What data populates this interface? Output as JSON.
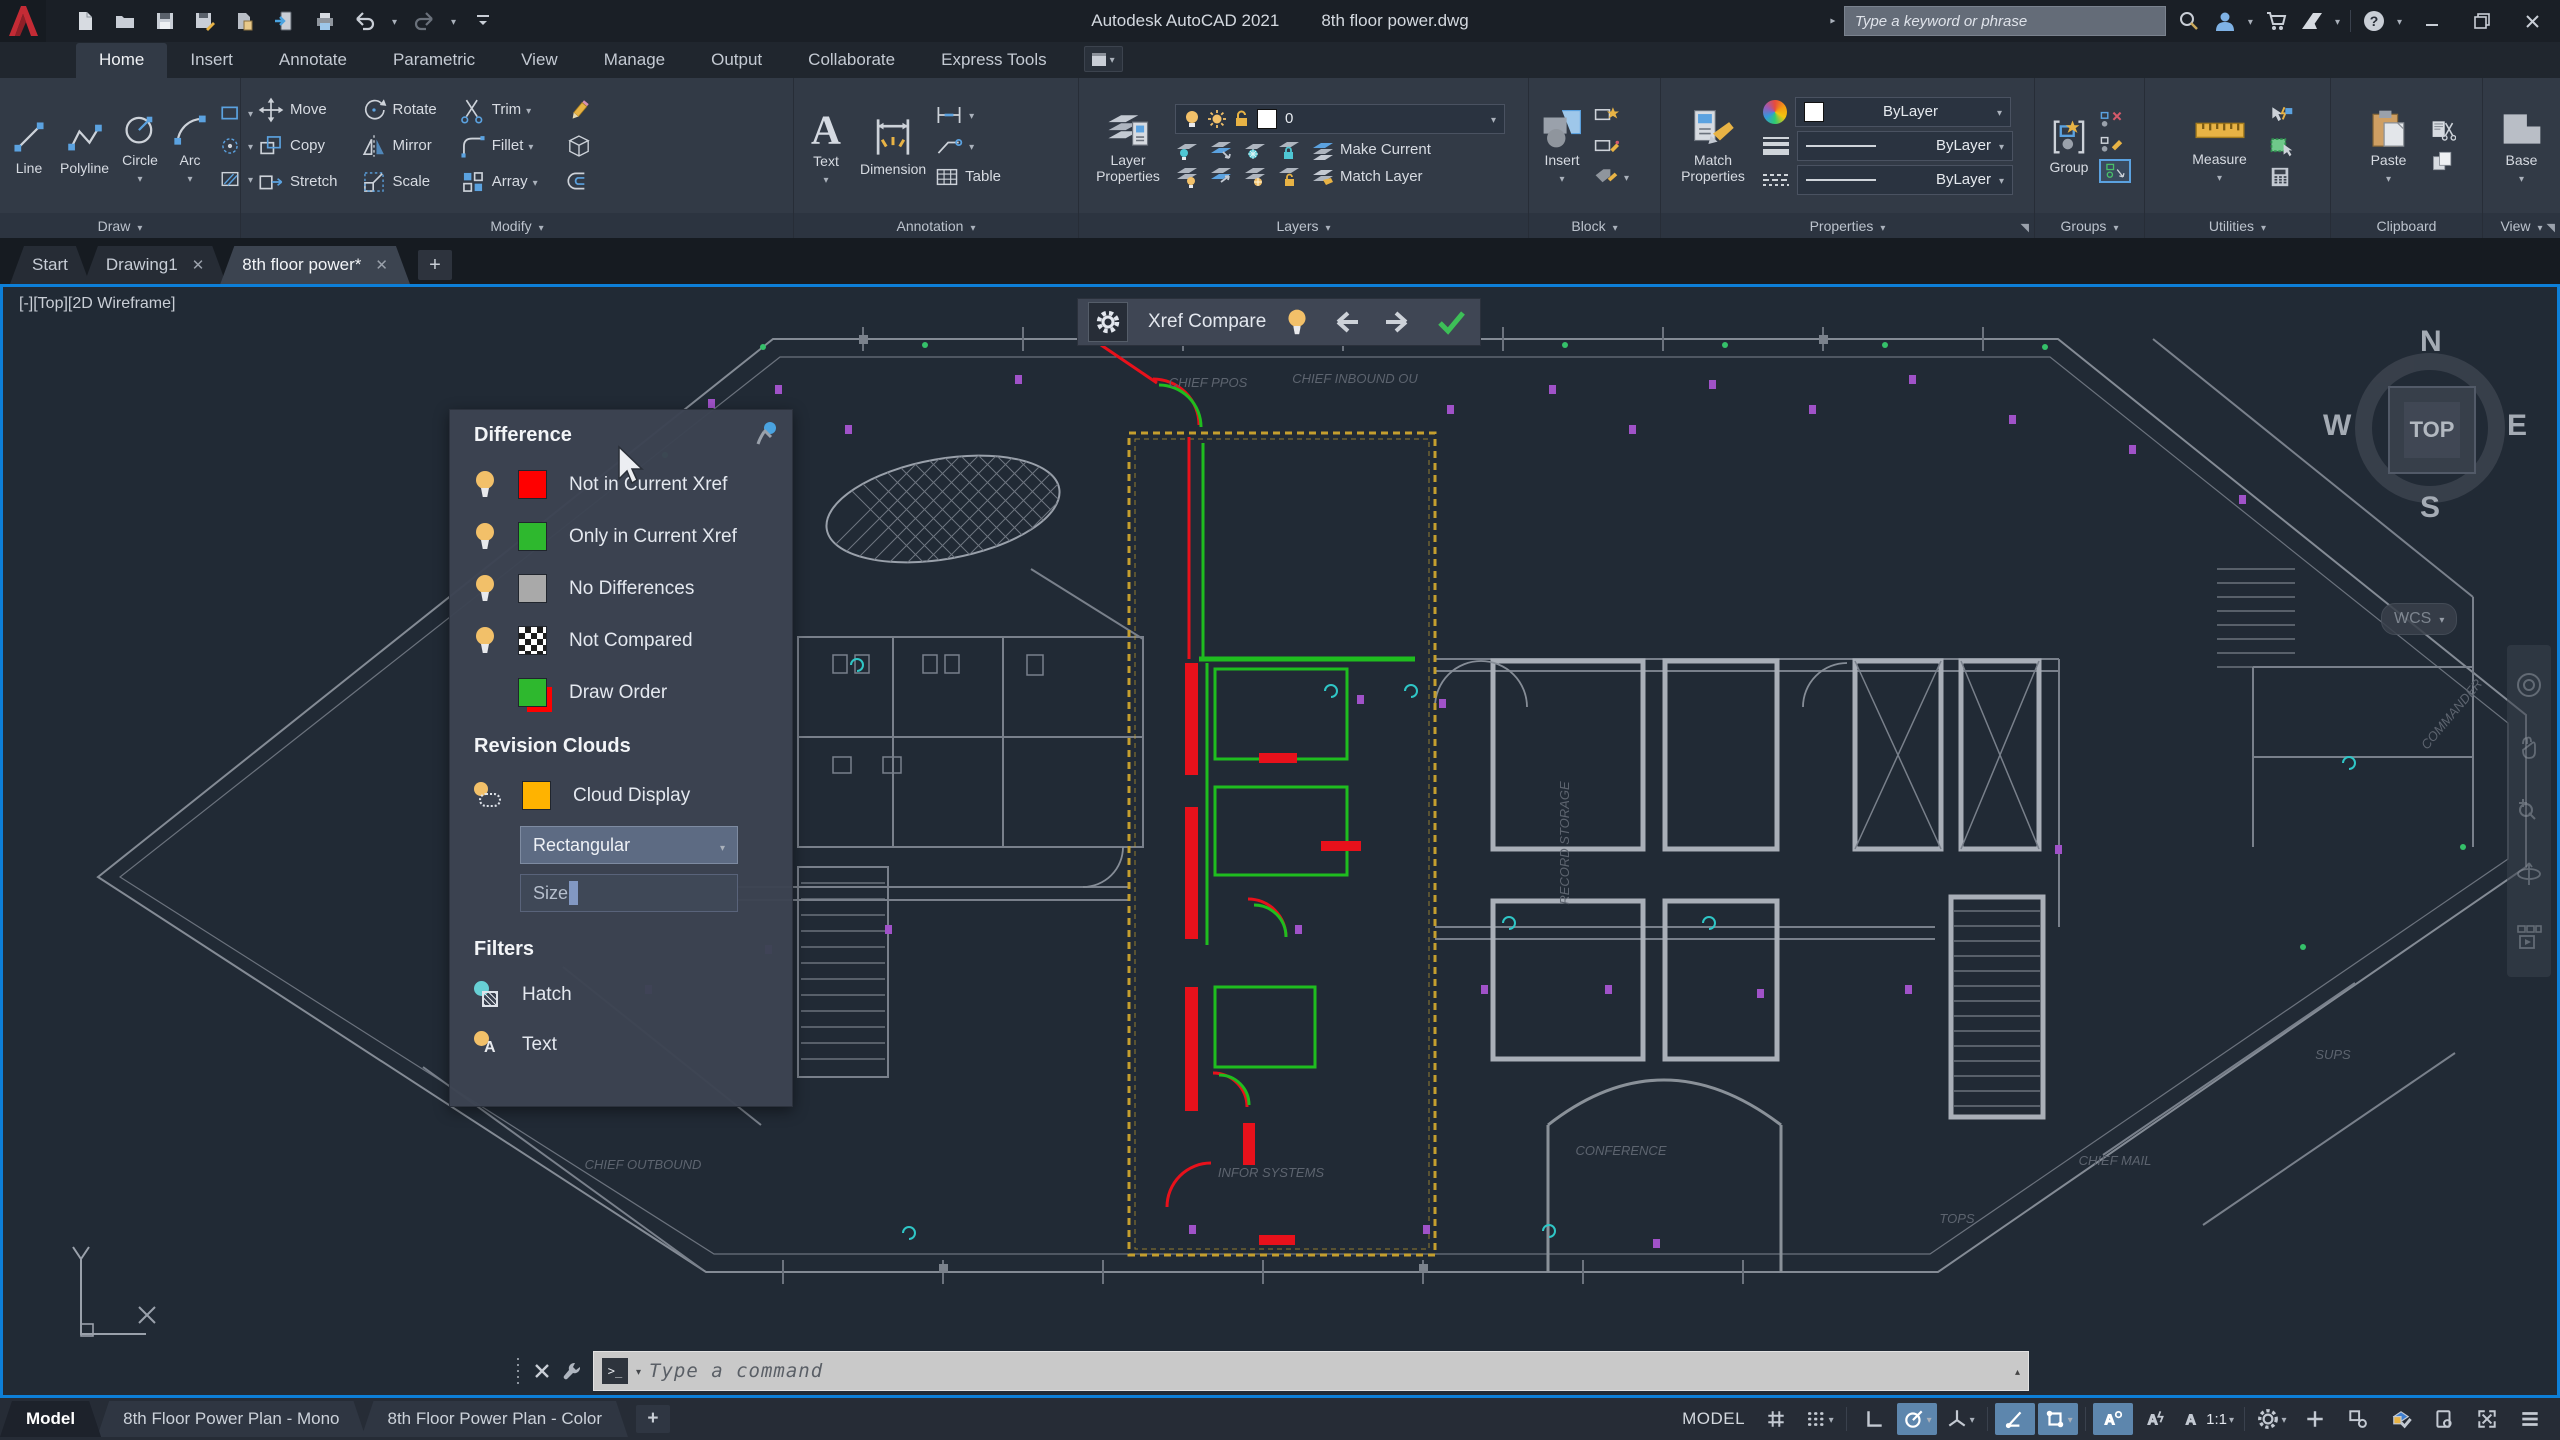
{
  "title_bar": {
    "app_title": "Autodesk AutoCAD 2021",
    "doc_title": "8th floor power.dwg",
    "search_placeholder": "Type a keyword or phrase",
    "icons": [
      "autocad-logo",
      "new",
      "open",
      "save",
      "save-as",
      "open-web-mobile",
      "save-web-mobile",
      "plot",
      "undo",
      "redo",
      "search",
      "sign-in",
      "cart",
      "autodesk-logo",
      "help",
      "minimize",
      "restore",
      "close"
    ]
  },
  "ribbon": {
    "tabs": [
      {
        "label": "Home",
        "active": true
      },
      {
        "label": "Insert"
      },
      {
        "label": "Annotate"
      },
      {
        "label": "Parametric"
      },
      {
        "label": "View"
      },
      {
        "label": "Manage"
      },
      {
        "label": "Output"
      },
      {
        "label": "Collaborate"
      },
      {
        "label": "Express Tools"
      }
    ],
    "draw": {
      "label": "Draw",
      "line": "Line",
      "polyline": "Polyline",
      "circle": "Circle",
      "arc": "Arc"
    },
    "modify": {
      "label": "Modify",
      "move": "Move",
      "rotate": "Rotate",
      "trim": "Trim",
      "copy": "Copy",
      "mirror": "Mirror",
      "fillet": "Fillet",
      "stretch": "Stretch",
      "scale": "Scale",
      "array": "Array"
    },
    "annotation": {
      "label": "Annotation",
      "text": "Text",
      "dimension": "Dimension",
      "table": "Table"
    },
    "layers": {
      "label": "Layers",
      "layer_properties": "Layer Properties",
      "current_layer": "0",
      "make_current": "Make Current",
      "match_layer": "Match Layer"
    },
    "block": {
      "label": "Block",
      "insert": "Insert"
    },
    "properties": {
      "label": "Properties",
      "match_properties": "Match Properties",
      "object_color": "ByLayer",
      "lineweight": "ByLayer",
      "linetype": "ByLayer"
    },
    "groups": {
      "label": "Groups",
      "group": "Group"
    },
    "utilities": {
      "label": "Utilities",
      "measure": "Measure"
    },
    "clipboard": {
      "label": "Clipboard",
      "paste": "Paste"
    },
    "view": {
      "label": "View",
      "base": "Base"
    }
  },
  "file_tabs": {
    "start": "Start",
    "drawing1": "Drawing1",
    "active_doc": "8th floor power*"
  },
  "viewport": {
    "label": "[-][Top][2D Wireframe]",
    "viewcube": {
      "n": "N",
      "s": "S",
      "e": "E",
      "w": "W",
      "top": "TOP",
      "wcs": "WCS"
    }
  },
  "xref_compare": {
    "title": "Xref Compare",
    "icons": [
      "settings-gear",
      "toggle-bulb",
      "previous-arrow",
      "next-arrow",
      "accept-check"
    ]
  },
  "compare_panel": {
    "difference_header": "Difference",
    "items": [
      {
        "label": "Not in Current Xref",
        "color": "#ff0000"
      },
      {
        "label": "Only in Current Xref",
        "color": "#2eb82e"
      },
      {
        "label": "No Differences",
        "color": "#a9a9a9"
      },
      {
        "label": "Not Compared",
        "color": "checkerboard"
      },
      {
        "label": "Draw Order",
        "color": "#2eb82e over #ff0000"
      }
    ],
    "revision_clouds_header": "Revision Clouds",
    "cloud_display": "Cloud Display",
    "cloud_color": "#ffb300",
    "shape_value": "Rectangular",
    "size_value": "Size",
    "filters_header": "Filters",
    "hatch": "Hatch",
    "text": "Text"
  },
  "command_line": {
    "placeholder": "Type a command"
  },
  "status_bar": {
    "layout_tabs": [
      {
        "label": "Model",
        "active": true
      },
      {
        "label": "8th Floor Power Plan - Mono",
        "active": false
      },
      {
        "label": "8th Floor Power Plan - Color",
        "active": false
      }
    ],
    "model_space": "MODEL",
    "annotation_scale": "1:1",
    "toggles_on": [
      "polar-tracking",
      "object-snap-tracking",
      "object-snap",
      "annotation-visibility"
    ]
  },
  "canvas": {
    "room_labels": [
      {
        "text": "CHIEF PPOS"
      },
      {
        "text": "CHIEF INBOUND OU"
      },
      {
        "text": "RECORD STORAGE"
      },
      {
        "text": "CONFERENCE"
      },
      {
        "text": "INFOR SYSTEMS"
      },
      {
        "text": "CHIEF OUTBOUND"
      },
      {
        "text": "CHIEF MAIL"
      },
      {
        "text": "TOPS"
      },
      {
        "text": "SUPS"
      },
      {
        "text": "COMMANDER"
      }
    ]
  },
  "colors": {
    "accent_blue": "#0d7fd8",
    "canvas_bg": "#212a35",
    "ribbon_bg": "#323a46",
    "titlebar_bg": "#1a1f26",
    "panel_bg": "#3c4352",
    "diff_red": "#ff0000",
    "diff_green": "#2eb82e",
    "cloud_gold": "#c59f2e",
    "status_toggle_on": "#5d86ad"
  }
}
